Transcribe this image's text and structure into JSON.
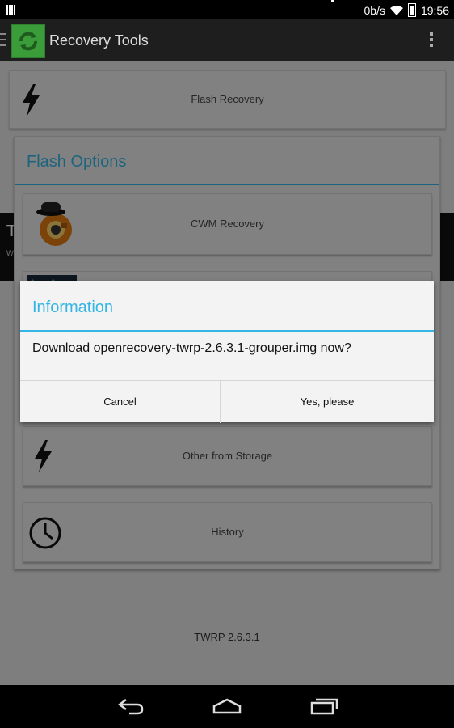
{
  "status_bar": {
    "net_speed": "0b/s",
    "time": "19:56"
  },
  "action_bar": {
    "title": "Recovery Tools",
    "icons": [
      "menu-lines-icon",
      "app-logo-icon",
      "overflow-menu-icon"
    ]
  },
  "cards": {
    "flash_recovery": {
      "label": "Flash Recovery",
      "icon": "lightning-icon"
    },
    "cwm_recovery": {
      "label": "CWM Recovery",
      "icon": "clockwork-icon"
    },
    "other_from_storage": {
      "label": "Other from Storage",
      "icon": "lightning-icon"
    },
    "history": {
      "label": "History",
      "icon": "clock-icon"
    }
  },
  "flash_options": {
    "title": "Flash Options"
  },
  "background_strip": {
    "text": "T",
    "subtext": "w"
  },
  "footer": {
    "version": "TWRP 2.6.3.1"
  },
  "dialog": {
    "title": "Information",
    "message": "Download openrecovery-twrp-2.6.3.1-grouper.img now?",
    "cancel_label": "Cancel",
    "confirm_label": "Yes, please"
  },
  "colors": {
    "accent": "#33b5e5",
    "dialog_bg": "#f3f3f3",
    "card_bg": "#ececec"
  }
}
